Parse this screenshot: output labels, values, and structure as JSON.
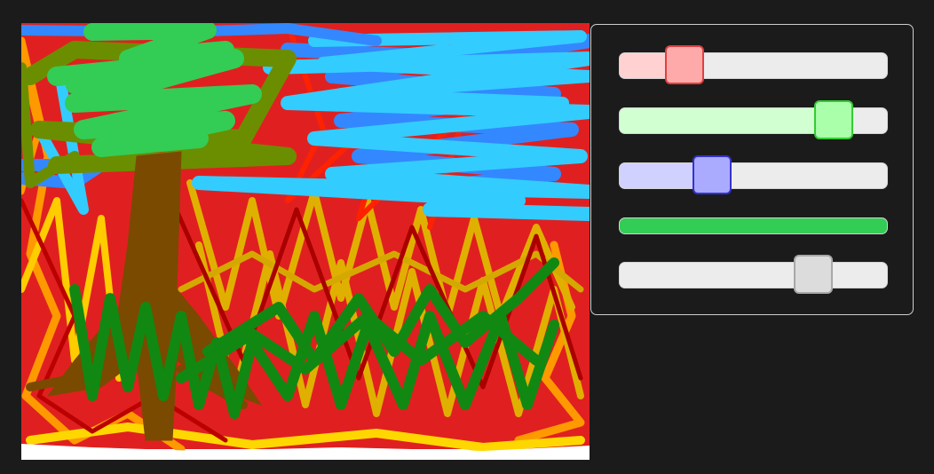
{
  "canvas": {
    "background": "#ffffff",
    "stroke_colors": [
      "#ff9900",
      "#ffd700",
      "#dd0000",
      "#cc0000",
      "#3388ff",
      "#33ccff",
      "#22aa22",
      "#118811",
      "#33cc55",
      "#7a4a00",
      "#6b8e00",
      "#d4a800"
    ]
  },
  "controls": {
    "red_slider": {
      "value": 0.2,
      "color": "#ffaaaa"
    },
    "green_slider": {
      "value": 0.85,
      "color": "#aaffaa"
    },
    "blue_slider": {
      "value": 0.32,
      "color": "#aaaaff"
    },
    "color_preview": {
      "color": "#33cc55"
    },
    "size_slider": {
      "value": 0.76
    }
  }
}
